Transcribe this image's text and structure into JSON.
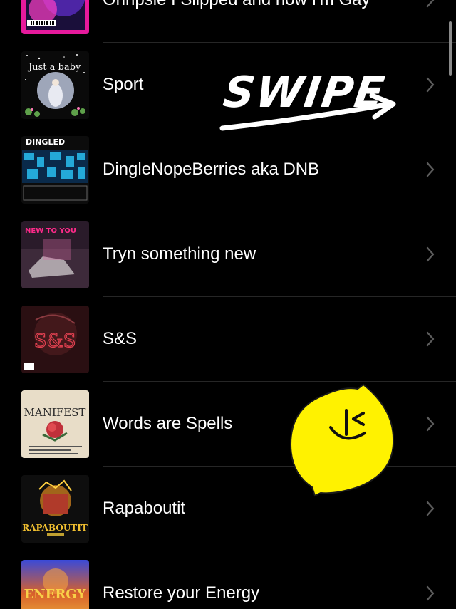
{
  "playlists": [
    {
      "title": "Ohnpsie I Slipped and now I'm Gay",
      "art_text": ""
    },
    {
      "title": "Sport",
      "art_text": "Just a baby"
    },
    {
      "title": "DingleNopeBerries aka DNB",
      "art_text": "DINGLED"
    },
    {
      "title": "Tryn something new",
      "art_text": "NEW TO YOU"
    },
    {
      "title": "S&S",
      "art_text": "S&S"
    },
    {
      "title": "Words are Spells",
      "art_text": "MANIFEST"
    },
    {
      "title": "Rapaboutit",
      "art_text": "RAPABOUTIT"
    },
    {
      "title": "Restore your Energy",
      "art_text": "ENERGY"
    }
  ],
  "overlay": {
    "swipe_text": "SWIPE",
    "sticker": "lemon-wink-sticker"
  },
  "colors": {
    "background": "#000000",
    "text": "#ffffff",
    "chevron": "#5c5c5c",
    "separator": "#262626",
    "lemon": "#fff200"
  }
}
